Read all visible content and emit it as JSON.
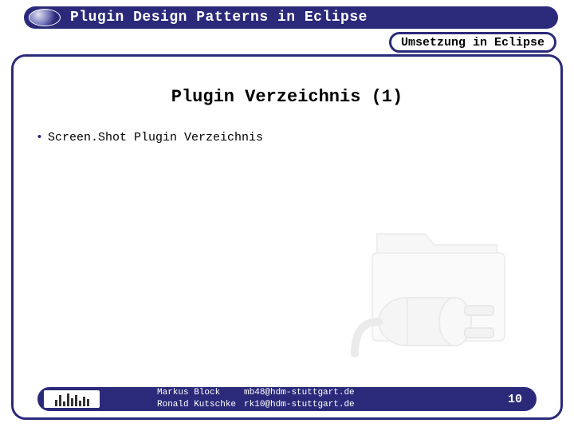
{
  "header": {
    "title": "Plugin Design Patterns in Eclipse"
  },
  "breadcrumb": {
    "label": "Umsetzung in Eclipse"
  },
  "slide": {
    "heading": "Plugin Verzeichnis (1)",
    "bullet1": "Screen.Shot Plugin Verzeichnis"
  },
  "footer": {
    "author1_name": "Markus Block",
    "author1_email": "mb48@hdm-stuttgart.de",
    "author2_name": "Ronald Kutschke",
    "author2_email": "rk10@hdm-stuttgart.de",
    "page": "10"
  }
}
